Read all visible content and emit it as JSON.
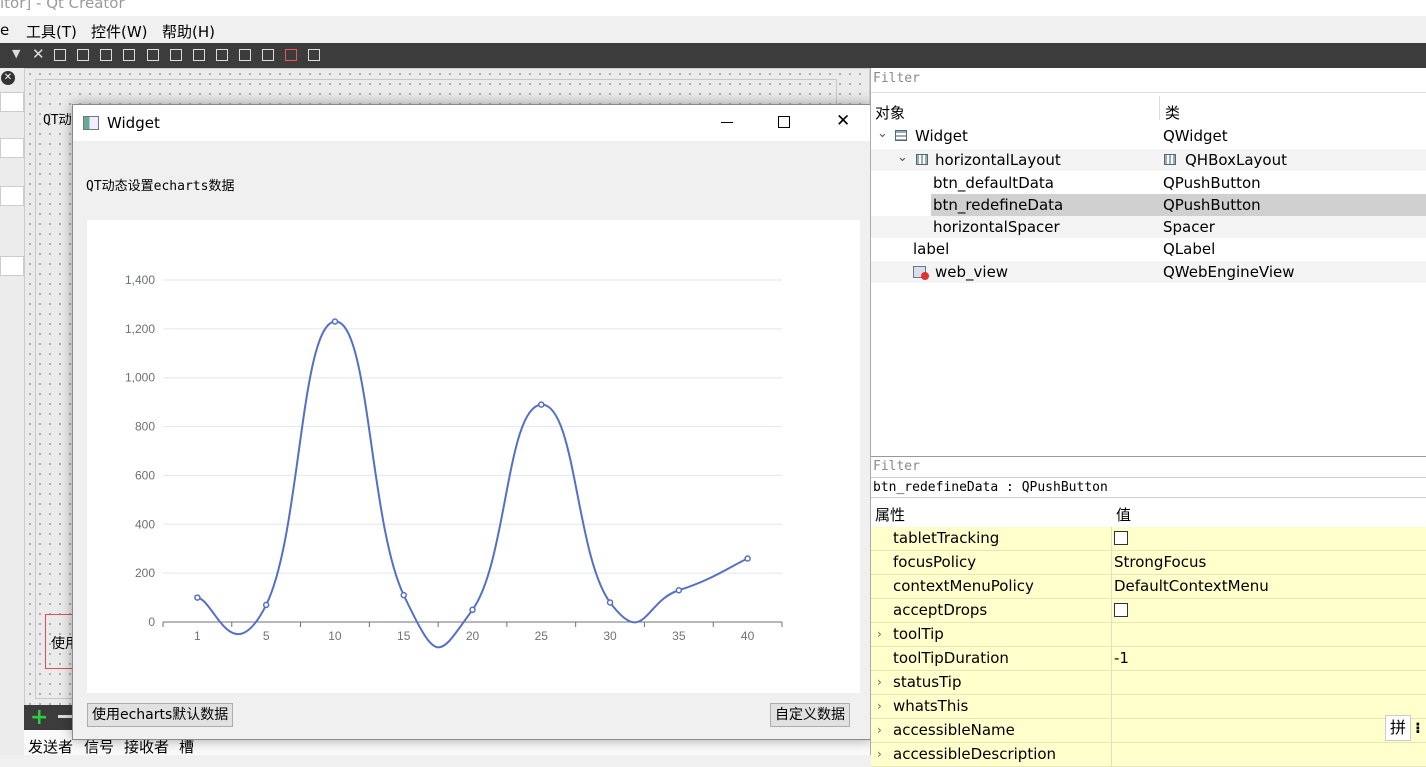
{
  "titlebar": {
    "text": "itor] - Qt Creator"
  },
  "menubar": {
    "items": [
      {
        "label": "e"
      },
      {
        "label": "工具(T)"
      },
      {
        "label": "控件(W)"
      },
      {
        "label": "帮助(H)"
      }
    ]
  },
  "canvas": {
    "label_fragment": "QT动",
    "button_fragment": "使用"
  },
  "bottom_tabs": [
    "发送者",
    "信号",
    "接收者",
    "槽"
  ],
  "widget_window": {
    "title": "Widget",
    "label": "QT动态设置echarts数据",
    "btn_default": "使用echarts默认数据",
    "btn_redefine": "自定义数据"
  },
  "chart_data": {
    "type": "line",
    "smooth": true,
    "categories": [
      "1",
      "5",
      "10",
      "15",
      "20",
      "25",
      "30",
      "35",
      "40"
    ],
    "series": [
      {
        "values": [
          100,
          70,
          1230,
          110,
          50,
          890,
          80,
          130,
          260
        ]
      }
    ],
    "ylim": [
      0,
      1400
    ],
    "yticks": [
      "0",
      "200",
      "400",
      "600",
      "800",
      "1,000",
      "1,200",
      "1,400"
    ],
    "grid": true,
    "colors": {
      "line": "#5470c6",
      "grid": "#e0e6f1",
      "axis": "#6e7079"
    }
  },
  "object_inspector": {
    "filter_placeholder": "Filter",
    "col_object": "对象",
    "col_class": "类",
    "rows": [
      {
        "name": "Widget",
        "cls": "QWidget"
      },
      {
        "name": "horizontalLayout",
        "cls": "QHBoxLayout"
      },
      {
        "name": "btn_defaultData",
        "cls": "QPushButton"
      },
      {
        "name": "btn_redefineData",
        "cls": "QPushButton"
      },
      {
        "name": "horizontalSpacer",
        "cls": "Spacer"
      },
      {
        "name": "label",
        "cls": "QLabel"
      },
      {
        "name": "web_view",
        "cls": "QWebEngineView"
      }
    ]
  },
  "property_editor": {
    "filter_placeholder": "Filter",
    "selected": "btn_redefineData : QPushButton",
    "col_property": "属性",
    "col_value": "值",
    "rows": [
      {
        "name": "tabletTracking",
        "value": ""
      },
      {
        "name": "focusPolicy",
        "value": "StrongFocus"
      },
      {
        "name": "contextMenuPolicy",
        "value": "DefaultContextMenu"
      },
      {
        "name": "acceptDrops",
        "value": ""
      },
      {
        "name": "toolTip",
        "value": ""
      },
      {
        "name": "toolTipDuration",
        "value": "-1"
      },
      {
        "name": "statusTip",
        "value": ""
      },
      {
        "name": "whatsThis",
        "value": ""
      },
      {
        "name": "accessibleName",
        "value": ""
      },
      {
        "name": "accessibleDescription",
        "value": ""
      }
    ]
  },
  "ime": {
    "label": "拼"
  }
}
